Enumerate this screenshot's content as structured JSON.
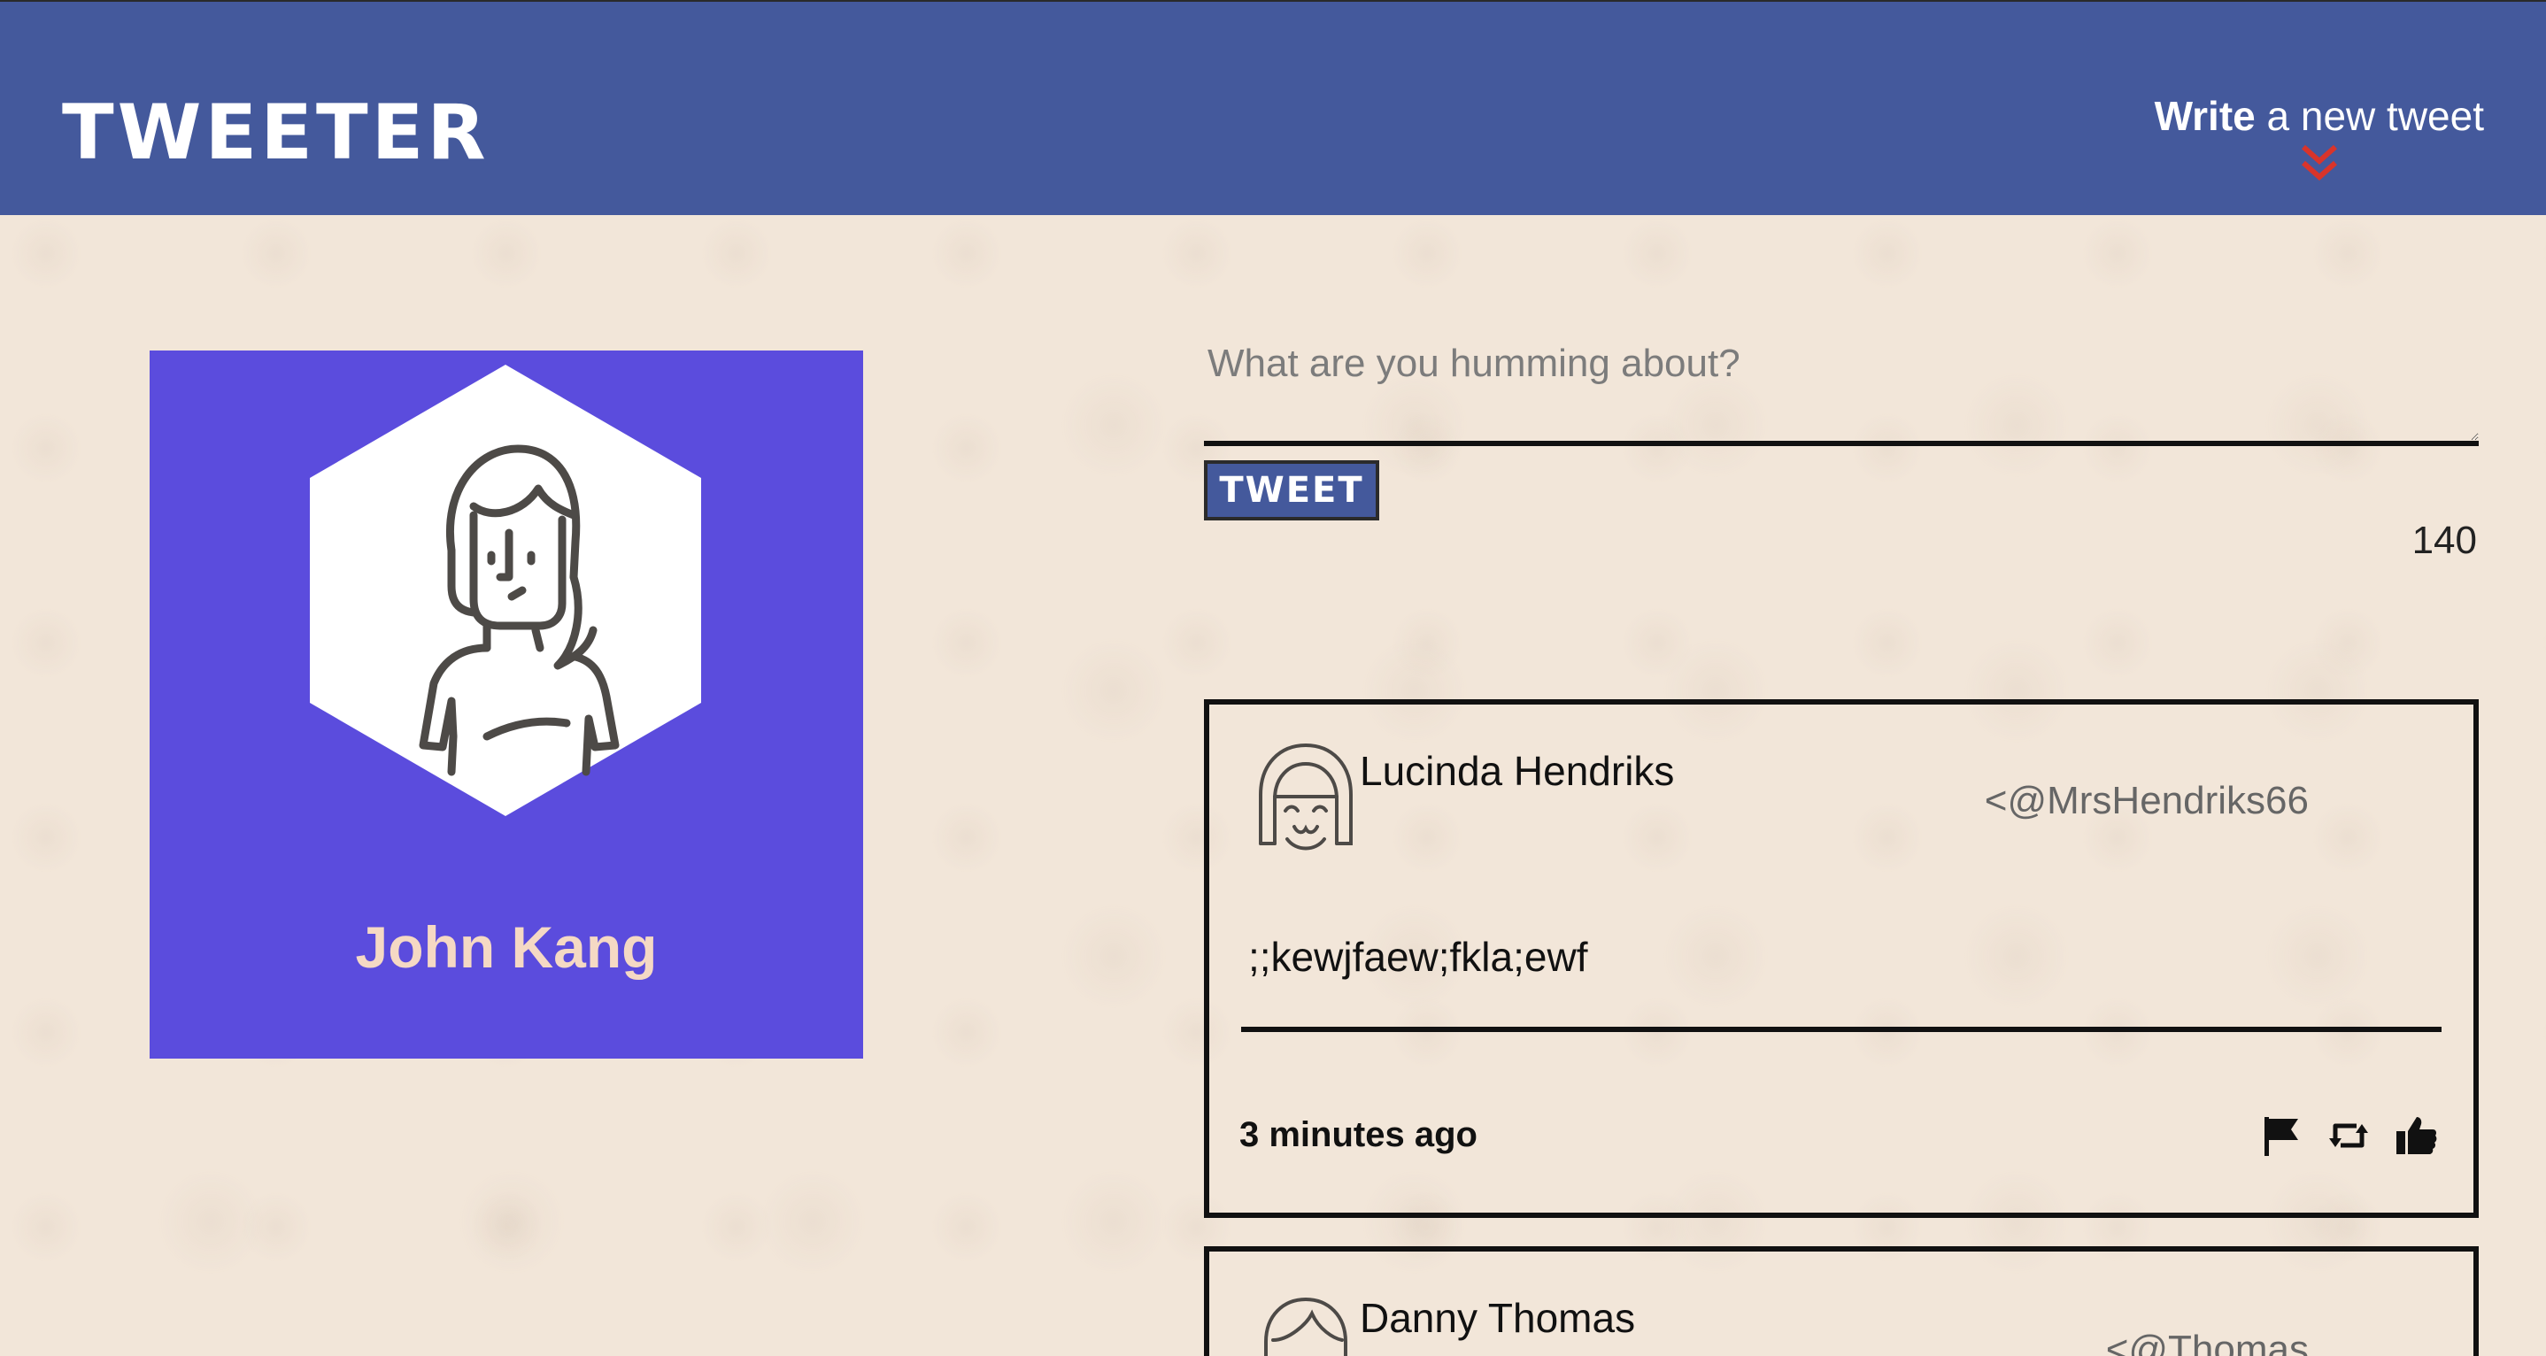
{
  "header": {
    "brand": "Tweeter",
    "compose_toggle_bold": "Write",
    "compose_toggle_rest": " a new tweet",
    "chevron_color": "#d9342b",
    "background": "#44599c"
  },
  "profile": {
    "name": "John Kang",
    "avatar_icon": "woman-avatar-icon",
    "card_color": "#5b4cdd"
  },
  "compose": {
    "placeholder": "What are you humming about?",
    "value": "",
    "submit_label": "TWEET",
    "char_counter": "140"
  },
  "tweets": [
    {
      "author": "Lucinda Hendriks",
      "handle": "<@MrsHendriks66",
      "text": ";;kewjfaew;fkla;ewf",
      "time": "3 minutes ago",
      "actions": [
        "flag-icon",
        "retweet-icon",
        "like-icon"
      ]
    },
    {
      "author": "Danny Thomas",
      "handle": "<@Thomas"
    }
  ]
}
